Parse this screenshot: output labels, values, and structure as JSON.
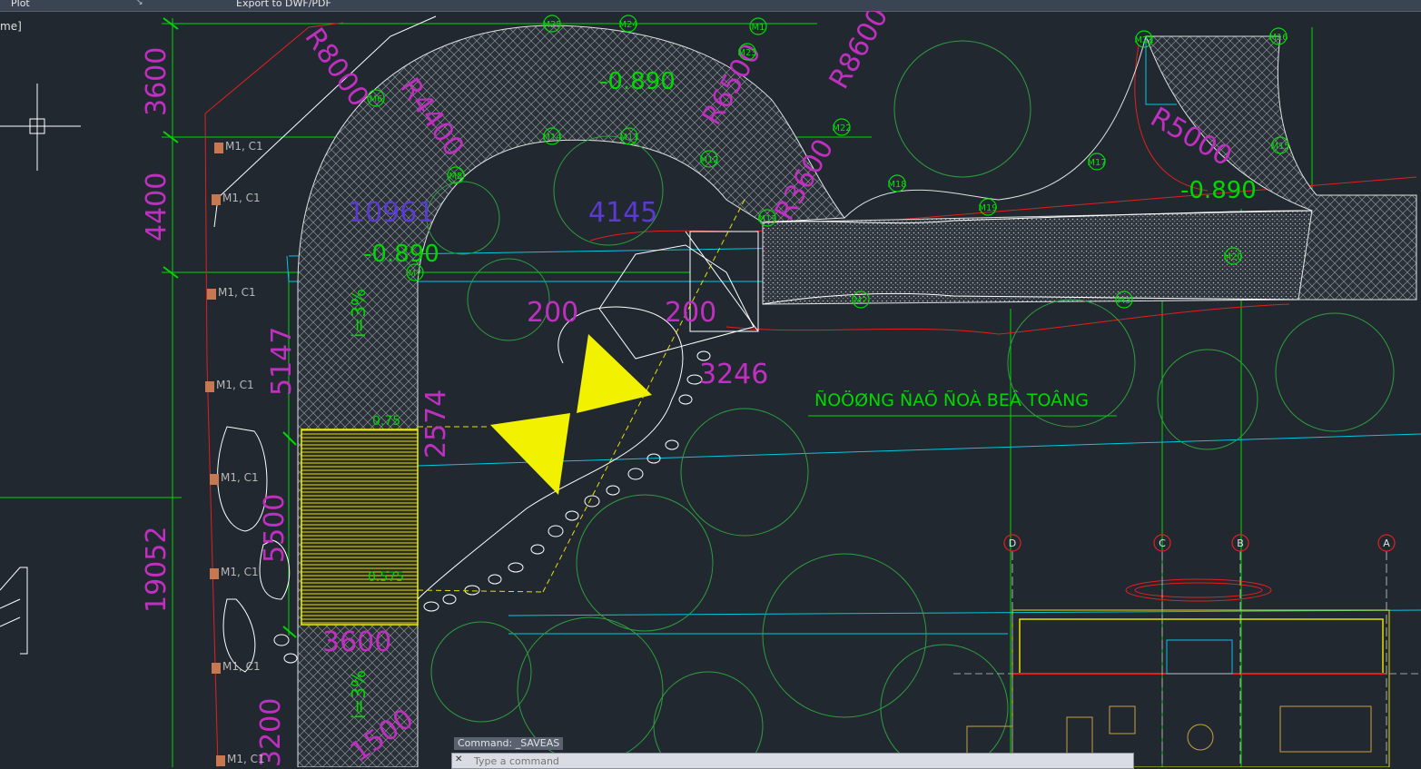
{
  "ribbon": {
    "panel_plot": "Plot",
    "export_button": "Export to DWF/PDF"
  },
  "viewport_label": "me]",
  "dimensions": {
    "d_3600_top": "3600",
    "d_4400": "4400",
    "d_5147": "5147",
    "d_19052": "19052",
    "d_5500": "5500",
    "d_3600_bottom": "3600",
    "d_10961": "10961",
    "d_4145": "4145",
    "d_2574": "2574",
    "d_3246": "3246",
    "d_200a": "200",
    "d_200b": "200",
    "d_3200": "3200",
    "d_1500": "1500"
  },
  "radii": {
    "r8000_left": "R8000",
    "r4400": "R4400",
    "r6500": "R6500",
    "r8600": "R8600",
    "r5000": "R5000",
    "r3600": "R3600"
  },
  "levels": {
    "lvl_top": "-0.890",
    "lvl_left": "-0.890",
    "lvl_right": "-0.890",
    "slope_1": "i=3%",
    "slope_2": "i=3%",
    "lvl_small1": "0.75",
    "lvl_small2": "0.575"
  },
  "markers": [
    "M25",
    "M24",
    "M1",
    "M23",
    "M22",
    "M18",
    "M19",
    "M17",
    "M21",
    "M16",
    "M15",
    "M20",
    "M3",
    "M2",
    "M13",
    "M12",
    "M11",
    "M14",
    "M5",
    "M6",
    "M7"
  ],
  "grid_bubbles": [
    "D",
    "C",
    "B",
    "A"
  ],
  "post_labels": [
    "M1, C1",
    "M1, C1",
    "M1, C1",
    "M1, C1",
    "M1, C1",
    "M1, C1",
    "M1, C1",
    "M1, C1"
  ],
  "vn_text": "ÑOÖØNG ÑAÕ ÑOÀ BEÂ TOÂNG",
  "command": {
    "history": "Command: _SAVEAS",
    "placeholder": "Type a command"
  }
}
